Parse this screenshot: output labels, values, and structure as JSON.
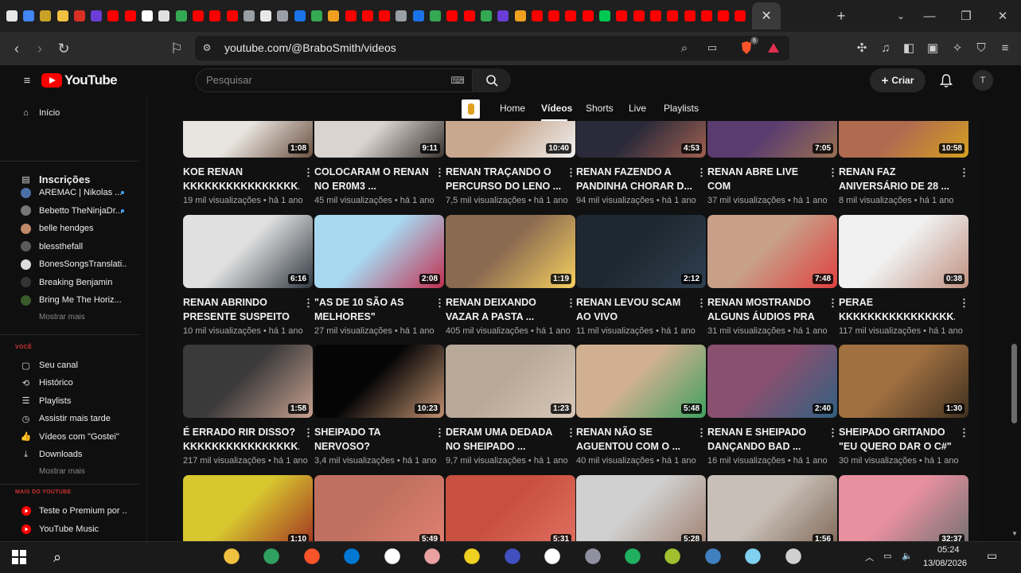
{
  "browser": {
    "url": "youtube.com/@BraboSmith/videos",
    "tab_close": "✕",
    "new_tab": "+",
    "tab_colors": [
      "#e8e8e8",
      "#4285f4",
      "#c9a227",
      "#f0c040",
      "#d93025",
      "#6a3dd6",
      "#ff0000",
      "#ff0000",
      "#ffffff",
      "#e0e0e0",
      "#34a853",
      "#ff0000",
      "#ff0000",
      "#ff0000",
      "#9aa0a6",
      "#e8e8e8",
      "#9aa0a6",
      "#1a73e8",
      "#34a853",
      "#f0a020",
      "#ff0000",
      "#ff0000",
      "#ff0000",
      "#9aa0a6",
      "#1a73e8",
      "#34a853",
      "#ff0000",
      "#ff0000",
      "#34a853",
      "#6a3dd6",
      "#f0a020",
      "#ff0000",
      "#ff0000",
      "#ff0000",
      "#ff0000",
      "#00c853",
      "#ff0000",
      "#ff0000",
      "#ff0000",
      "#ff0000",
      "#ff0000",
      "#ff0000",
      "#ff0000",
      "#ff0000"
    ],
    "brave_badge": "6"
  },
  "youtube": {
    "logo_text": "YouTube",
    "search_placeholder": "Pesquisar",
    "create_label": "Criar",
    "avatar_letter": "T"
  },
  "sidebar": {
    "home": "Início",
    "subs_header": "Inscrições",
    "subs": [
      {
        "label": "AREMAC | Nikolas ...",
        "color": "#4a6fa5",
        "dot": true
      },
      {
        "label": "Bebetto TheNinjaDr...",
        "color": "#777777",
        "dot": true
      },
      {
        "label": "belle hendges",
        "color": "#c08a6a",
        "dot": false
      },
      {
        "label": "blessthefall",
        "color": "#5a5a5a",
        "dot": false
      },
      {
        "label": "BonesSongsTranslati...",
        "color": "#dddddd",
        "dot": false
      },
      {
        "label": "Breaking Benjamin",
        "color": "#333333",
        "dot": false
      },
      {
        "label": "Bring Me The Horiz...",
        "color": "#3a5a2a",
        "dot": false
      }
    ],
    "more1": "Mostrar mais",
    "section_you": "VOCÊ",
    "you_items": [
      {
        "label": "Seu canal",
        "icon": "▢"
      },
      {
        "label": "Histórico",
        "icon": "⟲"
      },
      {
        "label": "Playlists",
        "icon": "☰"
      },
      {
        "label": "Assistir mais tarde",
        "icon": "◷"
      },
      {
        "label": "Vídeos com \"Gostei\"",
        "icon": "👍"
      },
      {
        "label": "Downloads",
        "icon": "⤓"
      }
    ],
    "more2": "Mostrar mais",
    "section_more": "MAIS DO YOUTUBE",
    "more_items": [
      {
        "label": "Teste o Premium por ..."
      },
      {
        "label": "YouTube Music"
      }
    ]
  },
  "channel_tabs": [
    "Home",
    "Vídeos",
    "Shorts",
    "Live",
    "Playlists"
  ],
  "videos": [
    {
      "title": "KOE RENAN\nKKKKKKKKKKKKKKKK...",
      "views": "19 mil visualizações",
      "age": "há 1 ano",
      "duration": "1:08",
      "c1": "#e8e4df",
      "c2": "#6b5040"
    },
    {
      "title": "COLOCARAM O RENAN\nNO ER0M3 ...",
      "views": "45 mil visualizações",
      "age": "há 1 ano",
      "duration": "9:11",
      "c1": "#d9d4cf",
      "c2": "#3a3430"
    },
    {
      "title": "RENAN TRAÇANDO O\nPERCURSO DO LENO ...",
      "views": "7,5 mil visualizações",
      "age": "há 1 ano",
      "duration": "10:40",
      "c1": "#c9a890",
      "c2": "#f0f0f0"
    },
    {
      "title": "RENAN FAZENDO A\nPANDINHA CHORAR D...",
      "views": "94 mil visualizações",
      "age": "há 1 ano",
      "duration": "4:53",
      "c1": "#2a2a3a",
      "c2": "#a06050"
    },
    {
      "title": "RENAN ABRE LIVE COM\nA VOZ ABOBALHADA ...",
      "views": "37 mil visualizações",
      "age": "há 1 ano",
      "duration": "7:05",
      "c1": "#5a3c70",
      "c2": "#9a7050"
    },
    {
      "title": "RENAN FAZ\nANIVERSÁRIO DE 28 ...",
      "views": "8 mil visualizações",
      "age": "há 1 ano",
      "duration": "10:58",
      "c1": "#b06a50",
      "c2": "#d4a020"
    },
    {
      "title": "RENAN ABRINDO\nPRESENTE SUSPEITO ...",
      "views": "10 mil visualizações",
      "age": "há 1 ano",
      "duration": "6:16",
      "c1": "#e0e0e0",
      "c2": "#303840"
    },
    {
      "title": "\"AS DE 10 SÃO AS\nMELHORES\"",
      "views": "27 mil visualizações",
      "age": "há 1 ano",
      "duration": "2:08",
      "c1": "#a8d8f0",
      "c2": "#c03050"
    },
    {
      "title": "RENAN DEIXANDO\nVAZAR A PASTA ...",
      "views": "405 mil visualizações",
      "age": "há 1 ano",
      "duration": "1:19",
      "c1": "#8a6a50",
      "c2": "#f5d060"
    },
    {
      "title": "RENAN LEVOU SCAM\nAO VIVO",
      "views": "11 mil visualizações",
      "age": "há 1 ano",
      "duration": "2:12",
      "c1": "#1e2830",
      "c2": "#304050"
    },
    {
      "title": "RENAN MOSTRANDO\nALGUNS ÁUDIOS PRA ...",
      "views": "31 mil visualizações",
      "age": "há 1 ano",
      "duration": "7:48",
      "c1": "#c8a088",
      "c2": "#e04040"
    },
    {
      "title": "PERAE\nKKKKKKKKKKKKKKKK...",
      "views": "117 mil visualizações",
      "age": "há 1 ano",
      "duration": "0:38",
      "c1": "#f0f0f0",
      "c2": "#c09080"
    },
    {
      "title": "É ERRADO RIR DISSO?\nKKKKKKKKKKKKKKKK...",
      "views": "217 mil visualizações",
      "age": "há 1 ano",
      "duration": "1:58",
      "c1": "#3a3a3a",
      "c2": "#c8a090"
    },
    {
      "title": "SHEIPADO TA\nNERVOSO?",
      "views": "3,4 mil visualizações",
      "age": "há 1 ano",
      "duration": "10:23",
      "c1": "#050505",
      "c2": "#c09070"
    },
    {
      "title": "DERAM UMA DEDADA\nNO SHEIPADO ...",
      "views": "9,7 mil visualizações",
      "age": "há 1 ano",
      "duration": "1:23",
      "c1": "#b8a898",
      "c2": "#d8c8b8"
    },
    {
      "title": "RENAN NÃO SE\nAGUENTOU COM O ...",
      "views": "40 mil visualizações",
      "age": "há 1 ano",
      "duration": "5:48",
      "c1": "#d0b090",
      "c2": "#40a060"
    },
    {
      "title": "RENAN E SHEIPADO\nDANÇANDO BAD ...",
      "views": "16 mil visualizações",
      "age": "há 1 ano",
      "duration": "2:40",
      "c1": "#8a5070",
      "c2": "#306080"
    },
    {
      "title": "SHEIPADO GRITANDO\n\"EU QUERO DAR O C#\" ...",
      "views": "30 mil visualizações",
      "age": "há 1 ano",
      "duration": "1:30",
      "c1": "#a07040",
      "c2": "#403020"
    },
    {
      "title": "",
      "views": "",
      "age": "",
      "duration": "1:10",
      "c1": "#d8c830",
      "c2": "#a03020"
    },
    {
      "title": "",
      "views": "",
      "age": "",
      "duration": "5:49",
      "c1": "#c07060",
      "c2": "#e08070"
    },
    {
      "title": "",
      "views": "",
      "age": "",
      "duration": "5:31",
      "c1": "#c85040",
      "c2": "#e07060"
    },
    {
      "title": "",
      "views": "",
      "age": "",
      "duration": "5:28",
      "c1": "#d0d0d0",
      "c2": "#a08070"
    },
    {
      "title": "",
      "views": "",
      "age": "",
      "duration": "1:56",
      "c1": "#c8c0b8",
      "c2": "#806858"
    },
    {
      "title": "",
      "views": "",
      "age": "",
      "duration": "32:37",
      "c1": "#e890a0",
      "c2": "#707070"
    }
  ],
  "taskbar": {
    "time": "05:24",
    "date": "13/08/2026",
    "apps": [
      "#f0c040",
      "#30a060",
      "#fb542b",
      "#0078d4",
      "#ffffff",
      "#e8a0a0",
      "#f0d020",
      "#4050c0",
      "#ffffff",
      "#9090a0",
      "#20b060",
      "#a0c030",
      "#4080c0",
      "#80d0f0",
      "#d0d0d0"
    ]
  }
}
